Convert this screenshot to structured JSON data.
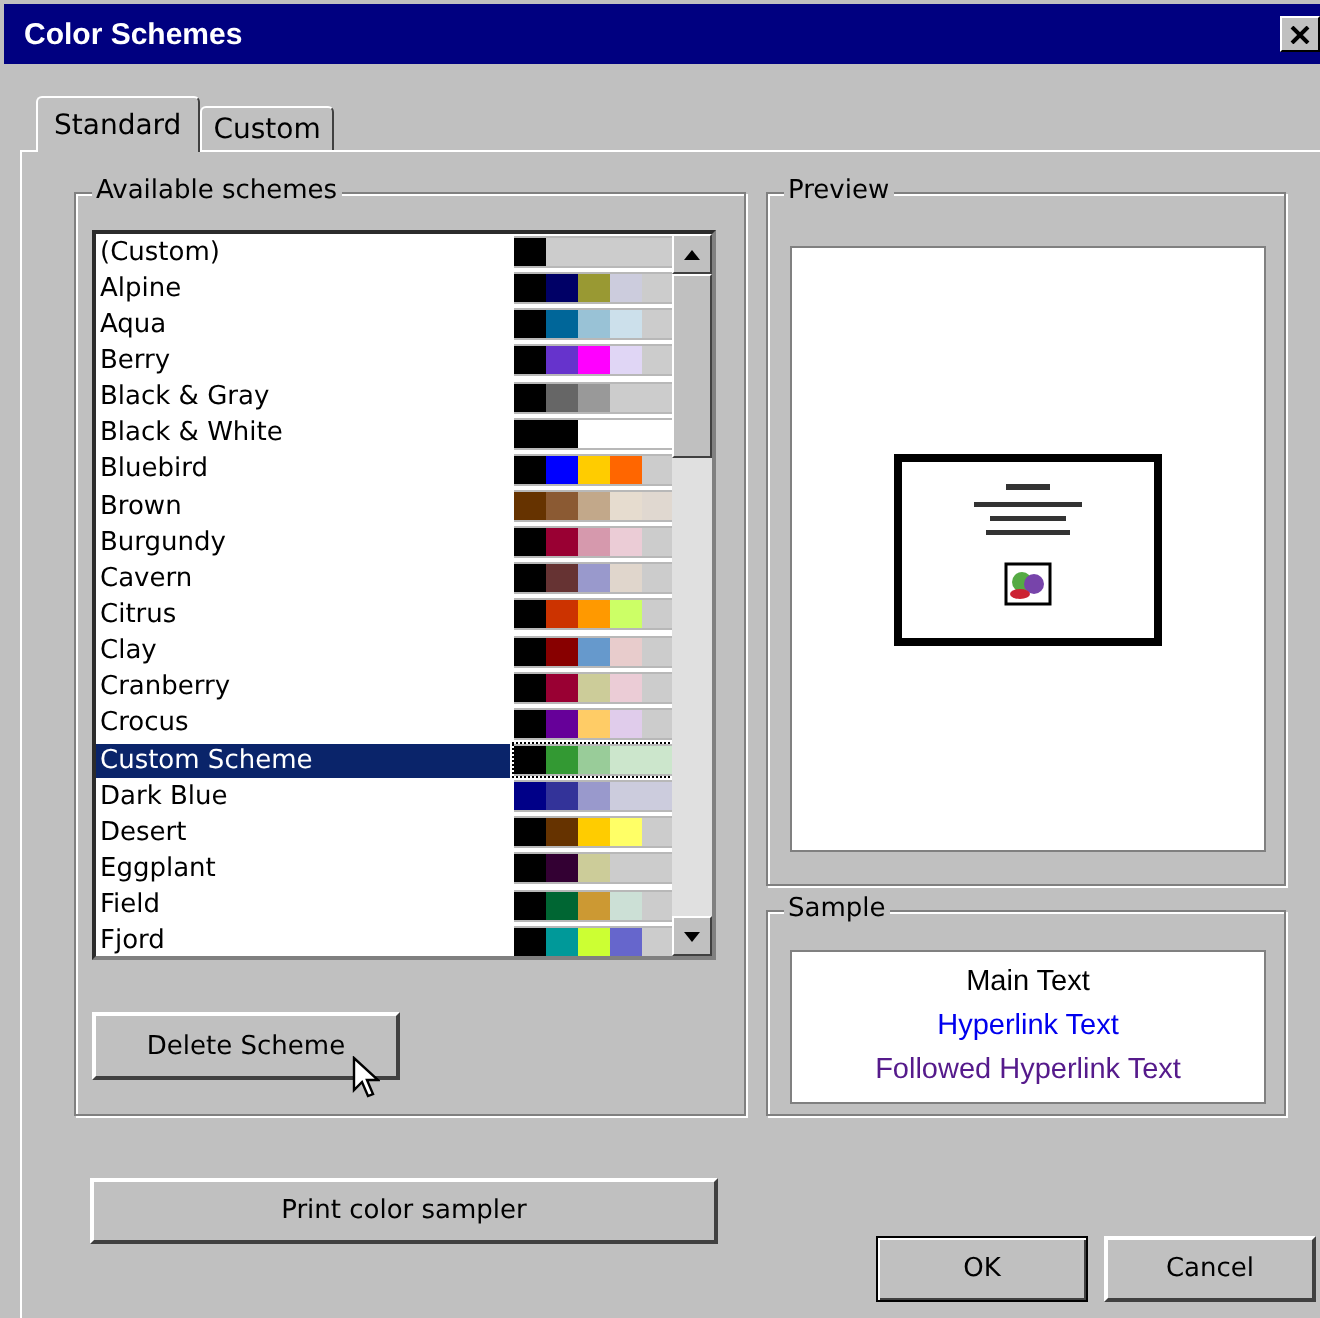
{
  "window": {
    "title": "Color Schemes"
  },
  "tabs": [
    {
      "label": "Standard",
      "selected": true
    },
    {
      "label": "Custom",
      "selected": false
    }
  ],
  "schemes_group": {
    "title": "Available schemes"
  },
  "schemes": [
    {
      "name": "(Custom)",
      "selected": false,
      "swatches": [
        {
          "color": "#000000"
        },
        {
          "color": "#cccccc"
        },
        {
          "color": "#cccccc"
        },
        {
          "color": "#cccccc"
        },
        {
          "color": "#cccccc"
        }
      ]
    },
    {
      "name": "Alpine",
      "selected": false,
      "swatches": [
        {
          "color": "#000000"
        },
        {
          "color": "#000066"
        },
        {
          "color": "#999933"
        },
        {
          "color": "#ccccdd"
        },
        {
          "color": "#cccccc"
        }
      ]
    },
    {
      "name": "Aqua",
      "selected": false,
      "swatches": [
        {
          "color": "#000000"
        },
        {
          "color": "#006699"
        },
        {
          "color": "#99c2d6"
        },
        {
          "color": "#cce0eb"
        },
        {
          "color": "#cccccc"
        }
      ]
    },
    {
      "name": "Berry",
      "selected": false,
      "swatches": [
        {
          "color": "#000000"
        },
        {
          "color": "#6633cc"
        },
        {
          "color": "#ff00ff"
        },
        {
          "color": "#e0d6f5"
        },
        {
          "color": "#cccccc"
        }
      ]
    },
    {
      "name": "Black & Gray",
      "selected": false,
      "swatches": [
        {
          "color": "#000000"
        },
        {
          "color": "#666666"
        },
        {
          "color": "#999999"
        },
        {
          "color": "#cccccc"
        },
        {
          "color": "#cccccc"
        }
      ]
    },
    {
      "name": "Black & White",
      "selected": false,
      "swatches": [
        {
          "color": "#000000"
        },
        {
          "color": "#000000"
        },
        {
          "color": "#ffffff"
        },
        {
          "color": "#ffffff"
        },
        {
          "color": "#ffffff"
        }
      ]
    },
    {
      "name": "Bluebird",
      "selected": false,
      "swatches": [
        {
          "color": "#000000"
        },
        {
          "color": "#0000ff"
        },
        {
          "color": "#ffcc00"
        },
        {
          "color": "#ff6600"
        },
        {
          "color": "#cccccc"
        }
      ]
    },
    {
      "name": "Brown",
      "selected": false,
      "swatches": [
        {
          "color": "#663300"
        },
        {
          "color": "#8b5a33"
        },
        {
          "color": "#c2a88a"
        },
        {
          "color": "#e6dccf"
        },
        {
          "color": "#e0d8d0"
        }
      ]
    },
    {
      "name": "Burgundy",
      "selected": false,
      "swatches": [
        {
          "color": "#000000"
        },
        {
          "color": "#990033"
        },
        {
          "color": "#d699ad"
        },
        {
          "color": "#ebccd6"
        },
        {
          "color": "#cccccc"
        }
      ]
    },
    {
      "name": "Cavern",
      "selected": false,
      "swatches": [
        {
          "color": "#000000"
        },
        {
          "color": "#663333"
        },
        {
          "color": "#9999cc"
        },
        {
          "color": "#e0d6cc"
        },
        {
          "color": "#cccccc"
        }
      ]
    },
    {
      "name": "Citrus",
      "selected": false,
      "swatches": [
        {
          "color": "#000000"
        },
        {
          "color": "#cc3300"
        },
        {
          "color": "#ff9900"
        },
        {
          "color": "#ccff66"
        },
        {
          "color": "#cccccc"
        }
      ]
    },
    {
      "name": "Clay",
      "selected": false,
      "swatches": [
        {
          "color": "#000000"
        },
        {
          "color": "#880000"
        },
        {
          "color": "#6699cc"
        },
        {
          "color": "#e8cccc"
        },
        {
          "color": "#cccccc"
        }
      ]
    },
    {
      "name": "Cranberry",
      "selected": false,
      "swatches": [
        {
          "color": "#000000"
        },
        {
          "color": "#990033"
        },
        {
          "color": "#cccc99"
        },
        {
          "color": "#ebccd6"
        },
        {
          "color": "#cccccc"
        }
      ]
    },
    {
      "name": "Crocus",
      "selected": false,
      "swatches": [
        {
          "color": "#000000"
        },
        {
          "color": "#660099"
        },
        {
          "color": "#ffcc66"
        },
        {
          "color": "#e0cceb"
        },
        {
          "color": "#cccccc"
        }
      ]
    },
    {
      "name": "Custom Scheme",
      "selected": true,
      "swatches": [
        {
          "color": "#000000"
        },
        {
          "color": "#339933"
        },
        {
          "color": "#99cc99"
        },
        {
          "color": "#cce6cc"
        },
        {
          "color": "#cce6cc"
        }
      ]
    },
    {
      "name": "Dark Blue",
      "selected": false,
      "swatches": [
        {
          "color": "#000088"
        },
        {
          "color": "#333399"
        },
        {
          "color": "#9999cc"
        },
        {
          "color": "#ccccdd"
        },
        {
          "color": "#ccccdd"
        }
      ]
    },
    {
      "name": "Desert",
      "selected": false,
      "swatches": [
        {
          "color": "#000000"
        },
        {
          "color": "#663300"
        },
        {
          "color": "#ffcc00"
        },
        {
          "color": "#ffff66"
        },
        {
          "color": "#cccccc"
        }
      ]
    },
    {
      "name": "Eggplant",
      "selected": false,
      "swatches": [
        {
          "color": "#000000"
        },
        {
          "color": "#330033"
        },
        {
          "color": "#cccc99"
        },
        {
          "color": "#cccccc"
        },
        {
          "color": "#cccccc"
        }
      ]
    },
    {
      "name": "Field",
      "selected": false,
      "swatches": [
        {
          "color": "#000000"
        },
        {
          "color": "#006633"
        },
        {
          "color": "#cc9933"
        },
        {
          "color": "#cce0d6"
        },
        {
          "color": "#cccccc"
        }
      ]
    },
    {
      "name": "Fjord",
      "selected": false,
      "swatches": [
        {
          "color": "#000000"
        },
        {
          "color": "#009999"
        },
        {
          "color": "#ccff33"
        },
        {
          "color": "#6666cc"
        },
        {
          "color": "#cccccc"
        }
      ]
    }
  ],
  "delete_button": "Delete Scheme",
  "print_button": "Print color sampler",
  "preview_group": {
    "title": "Preview"
  },
  "sample_group": {
    "title": "Sample"
  },
  "sample_lines": [
    {
      "text": "Main Text",
      "kind": "normal"
    },
    {
      "text": "Hyperlink Text",
      "kind": "link"
    },
    {
      "text": "Followed Hyperlink Text",
      "kind": "visited"
    }
  ],
  "buttons": [
    {
      "label": "OK",
      "default": true
    },
    {
      "label": "Cancel",
      "default": false
    }
  ]
}
